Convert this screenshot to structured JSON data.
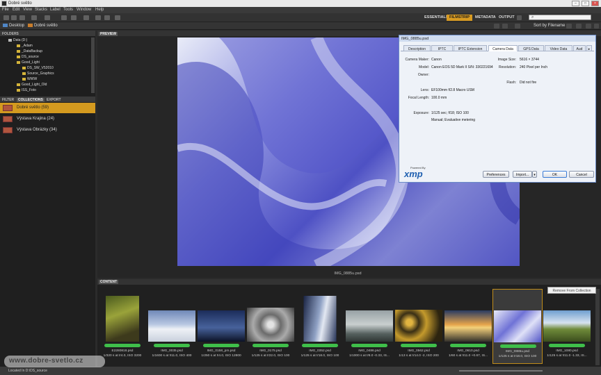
{
  "window": {
    "title": "Dobré světlo"
  },
  "menu": [
    "File",
    "Edit",
    "View",
    "Stacks",
    "Label",
    "Tools",
    "Window",
    "Help"
  ],
  "workspaces": [
    "ESSENTIALS",
    "FILMSTRIP",
    "METADATA",
    "OUTPUT"
  ],
  "workspace_active": "FILMSTRIP",
  "sort_label": "Sort by Filename",
  "path": [
    "Desktop",
    "Dobré světlo"
  ],
  "panels": {
    "folders_title": "FOLDERS",
    "preview_title": "PREVIEW",
    "content_title": "CONTENT",
    "tabs": [
      "FILTER",
      "COLLECTIONS",
      "EXPORT"
    ],
    "active_tab": "COLLECTIONS"
  },
  "tree": [
    "Data (D:)",
    "_Adam",
    "_DataBackup",
    "DS_source",
    "Good_Light",
    "DS_SW_V52010",
    "Source_Graphics",
    "WWW",
    "Good_Light_Old",
    "ISS_Foto"
  ],
  "collections": [
    {
      "name": "Dobré světlo (59)",
      "selected": true
    },
    {
      "name": "Výstava Krajina (24)",
      "selected": false
    },
    {
      "name": "Výstava Obrázky (34)",
      "selected": false
    }
  ],
  "preview_filename": "IMG_0885u.psd",
  "dialog": {
    "title": "IMG_0885u.psd",
    "tabs": [
      "Description",
      "IPTC",
      "IPTC Extension",
      "Camera Data",
      "GPS Data",
      "Video Data",
      "Aud"
    ],
    "active_tab": "Camera Data",
    "fields": {
      "camera_maker_label": "Camera Maker:",
      "camera_maker": "Canon",
      "model_label": "Model:",
      "model": "Canon EOS 5D Mark II  S/N: 330221694",
      "owner_label": "Owner:",
      "owner": "",
      "image_size_label": "Image Size:",
      "image_size": "5616 × 3744",
      "resolution_label": "Resolution:",
      "resolution": "240 Pixel per Inch",
      "flash_label": "Flash:",
      "flash": "Did not fire",
      "lens_label": "Lens:",
      "lens": "EF100mm f/2.8 Macro USM",
      "focal_label": "Focal Length:",
      "focal": "100.0 mm",
      "exposure_label": "Exposure:",
      "exposure": "1/125 sec;  f/18;  ISO 100",
      "mode": "Manual;  Evaluative metering"
    },
    "powered_by": "Powered By",
    "xmp": "xmp",
    "buttons": {
      "preferences": "Preferences",
      "import": "Import...",
      "ok": "OK",
      "cancel": "Cancel"
    }
  },
  "content": {
    "remove_button": "Remove From Collection",
    "thumbs": [
      {
        "name": "E2280818.psd",
        "meta": "1/320 s at f/4.0, ISO 3200",
        "kind": "moss"
      },
      {
        "name": "IMG_0035.psd",
        "meta": "1/1600 s at f/11.0, ISO 400",
        "kind": "snow"
      },
      {
        "name": "IMG_0158_pm.psd",
        "meta": "1/250 s at f/4.0, ISO 12800",
        "kind": "storm"
      },
      {
        "name": "IMG_0175.psd",
        "meta": "1/125 s at f/22.0, ISO 100",
        "kind": "eye"
      },
      {
        "name": "IMG_0352.psd",
        "meta": "1/125 s at f/18.0, ISO 100",
        "kind": "ice"
      },
      {
        "name": "IMG_0486.psd",
        "meta": "1/1000 s at f/8.0 -0.33, IS...",
        "kind": "fog"
      },
      {
        "name": "IMG_0562.psd",
        "meta": "1/13 s at f/14.0 -2, ISO 200",
        "kind": "gold"
      },
      {
        "name": "IMG_0610.psd",
        "meta": "1/60 s at f/11.0 +0.67, IS...",
        "kind": "sunset"
      },
      {
        "name": "IMG_0885u.psd",
        "meta": "1/125 s at f/18.0, ISO 100",
        "kind": "blue",
        "selected": true
      },
      {
        "name": "IMG_1080.psd",
        "meta": "1/125 s at f/11.0 -1.33, IS...",
        "kind": "hill"
      }
    ]
  },
  "status": "Located In D:\\DS_source",
  "watermark": "www.dobre-svetlo.cz"
}
